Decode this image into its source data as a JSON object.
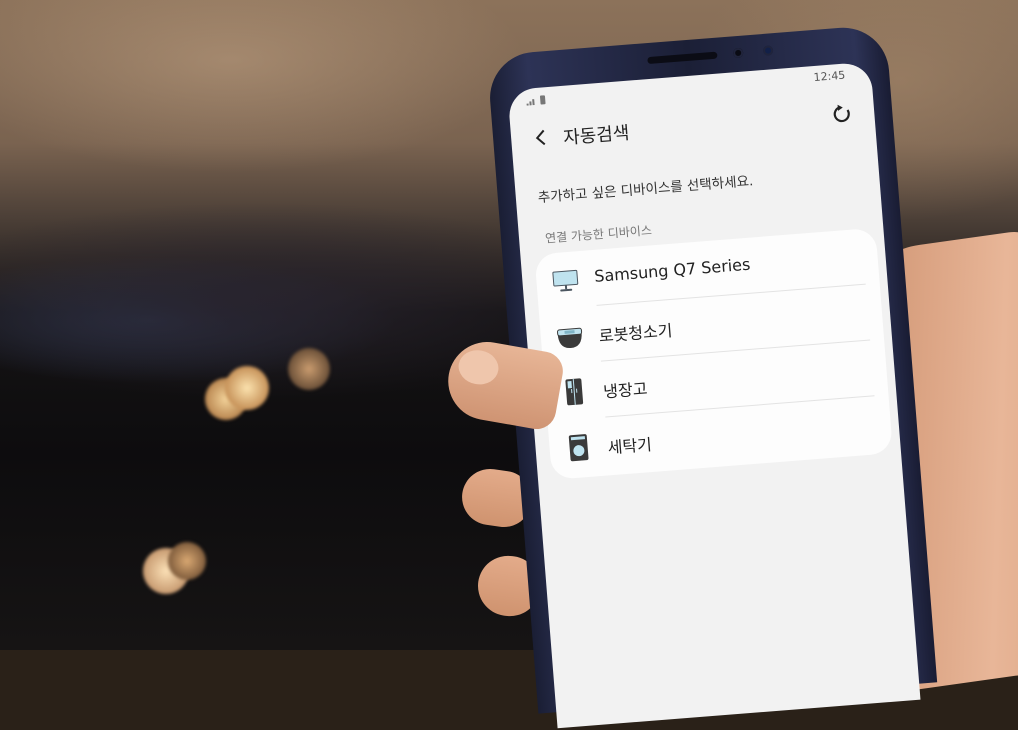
{
  "status_bar": {
    "time": "12:45"
  },
  "app_bar": {
    "title": "자동검색",
    "back_icon": "chevron-left-icon",
    "refresh_icon": "refresh-icon"
  },
  "instruction": "추가하고 싶은 디바이스를 선택하세요.",
  "section_label": "연결 가능한 디바이스",
  "devices": [
    {
      "label": "Samsung Q7 Series",
      "icon": "tv-icon"
    },
    {
      "label": "로봇청소기",
      "icon": "robot-vacuum-icon"
    },
    {
      "label": "냉장고",
      "icon": "refrigerator-icon"
    },
    {
      "label": "세탁기",
      "icon": "washing-machine-icon"
    }
  ],
  "colors": {
    "screen_background": "#f2f2f2",
    "card_background": "#fdfdfd",
    "phone_frame": "#2d3356",
    "icon_light_blue": "#bfe3ef",
    "icon_dark": "#333333"
  }
}
